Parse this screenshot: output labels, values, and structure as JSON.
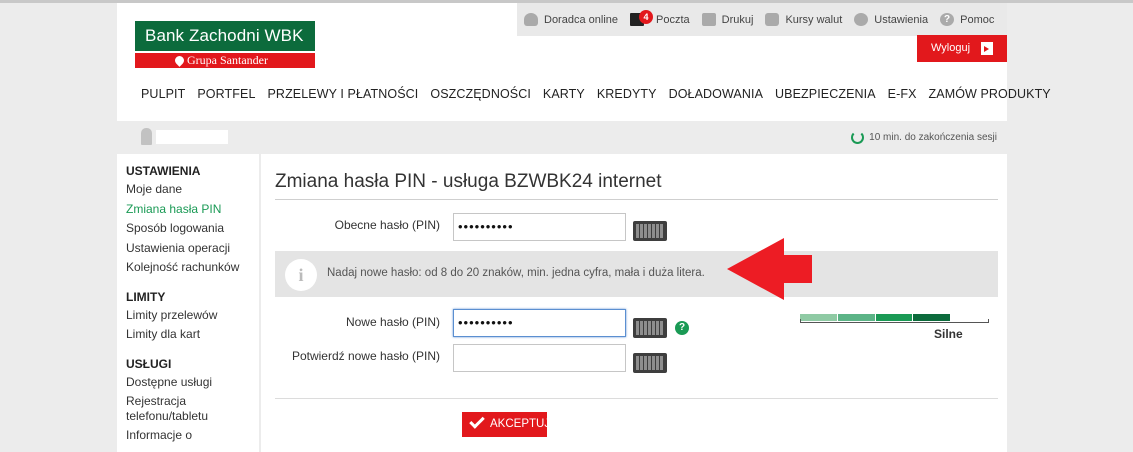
{
  "brand": {
    "name": "Bank Zachodni WBK",
    "group": "Grupa Santander",
    "colors": {
      "green": "#0c6b3c",
      "red": "#e2181c",
      "accent_green": "#1a9a55"
    }
  },
  "toolbar": {
    "advisor": "Doradca online",
    "mail": "Poczta",
    "mail_count": "4",
    "print": "Drukuj",
    "rates": "Kursy walut",
    "settings": "Ustawienia",
    "help": "Pomoc",
    "icons": [
      "person-icon",
      "mail-icon",
      "printer-icon",
      "exchange-icon",
      "gear-icon",
      "help-icon"
    ]
  },
  "logout": {
    "label": "Wyloguj"
  },
  "nav": [
    "PULPIT",
    "PORTFEL",
    "PRZELEWY I PŁATNOŚCI",
    "OSZCZĘDNOŚCI",
    "KARTY",
    "KREDYTY",
    "DOŁADOWANIA",
    "UBEZPIECZENIA",
    "E-FX",
    "ZAMÓW PRODUKTY"
  ],
  "session": {
    "text": "10 min. do zakończenia sesji"
  },
  "sidebar": {
    "settings": {
      "heading": "USTAWIENIA",
      "items": [
        "Moje dane",
        "Zmiana hasła PIN",
        "Sposób logowania",
        "Ustawienia operacji",
        "Kolejność rachunków"
      ],
      "active": "Zmiana hasła PIN"
    },
    "limits": {
      "heading": "LIMITY",
      "items": [
        "Limity przelewów",
        "Limity dla kart"
      ]
    },
    "services": {
      "heading": "USŁUGI",
      "items": [
        "Dostępne usługi",
        "Rejestracja telefonu/tabletu",
        "Informacje o"
      ]
    }
  },
  "form": {
    "title": "Zmiana hasła PIN - usługa BZWBK24 internet",
    "current_label": "Obecne hasło (PIN)",
    "current_value": "••••••••••",
    "info_text": "Nadaj nowe hasło: od 8 do 20 znaków, min. jedna cyfra, mała i duża litera.",
    "new_label": "Nowe hasło (PIN)",
    "new_value": "••••••••••",
    "confirm_label": "Potwierdź nowe hasło (PIN)",
    "confirm_value": "",
    "strength_label": "Silne",
    "strength_level": 4,
    "strength_max": 5,
    "strength_colors": [
      "#8fcaa4",
      "#5cb487",
      "#1a9a55",
      "#0c6b3c"
    ],
    "accept_label": "AKCEPTUJ"
  }
}
